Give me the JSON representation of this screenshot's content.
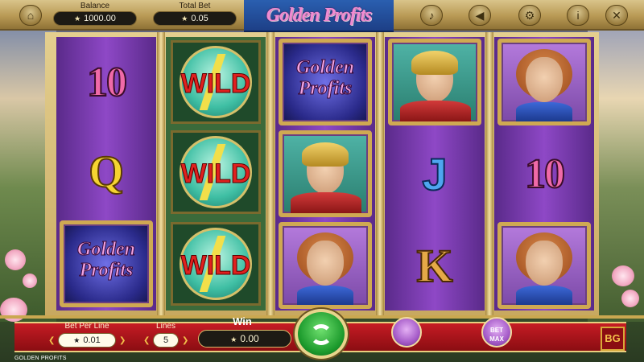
{
  "game": {
    "logo": "Golden Profits",
    "footer_name": "GOLDEN PROFITS"
  },
  "top_bar": {
    "balance_label": "Balance",
    "balance_value": "1000.00",
    "total_bet_label": "Total Bet",
    "total_bet_value": "0.05",
    "icons": [
      "home-icon",
      "music-icon",
      "sound-icon",
      "settings-icon",
      "info-icon",
      "close-icon"
    ]
  },
  "reels": [
    [
      "10",
      "Q",
      "Golden Profits"
    ],
    [
      "WILD",
      "WILD",
      "WILD"
    ],
    [
      "Golden Profits",
      "Hermes",
      "Lady"
    ],
    [
      "Hermes",
      "J",
      "K"
    ],
    [
      "Lady",
      "10",
      "Lady"
    ]
  ],
  "bottom_bar": {
    "bet_per_line_label": "Bet Per Line",
    "bet_per_line_value": "0.01",
    "lines_label": "Lines",
    "lines_value": "5",
    "win_label": "Win",
    "win_value": "0.00",
    "autoplay_label": "",
    "bet_max_label": "BET\nMAX",
    "badge": "BG"
  },
  "colors": {
    "top_bar": "#b99a55",
    "red_band": "#c61c24",
    "reel_purple": "#8e48c6",
    "spin_green": "#1c9a2c"
  }
}
